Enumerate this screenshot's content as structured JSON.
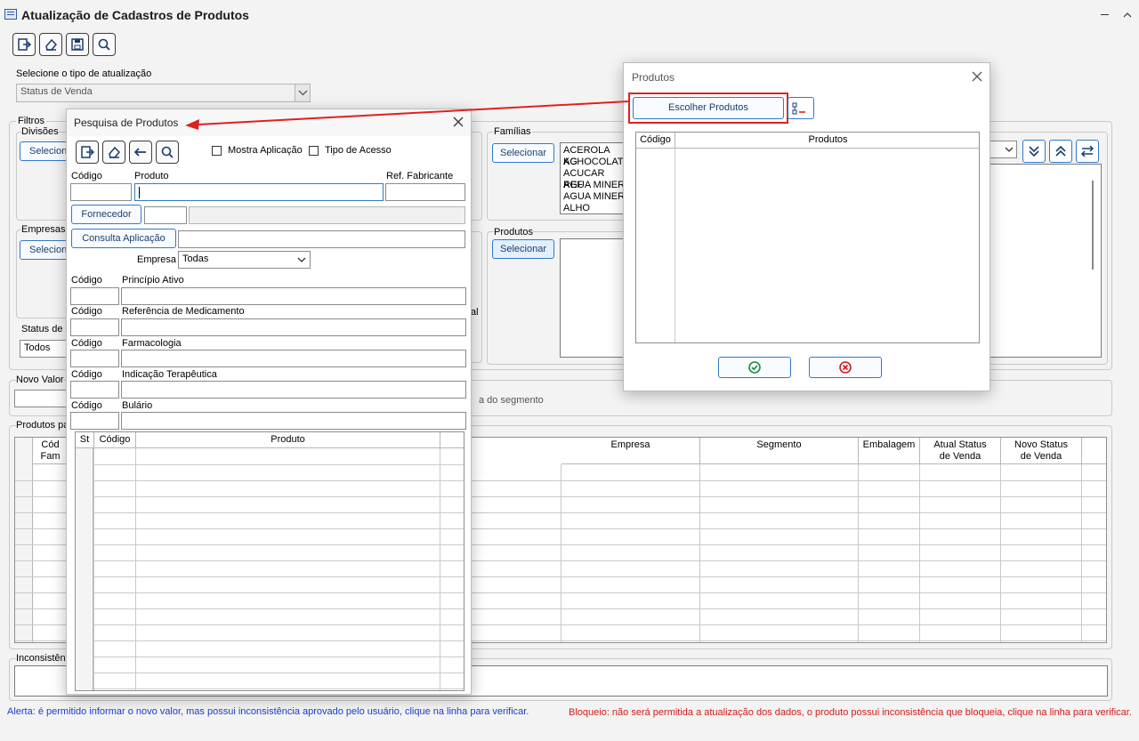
{
  "window": {
    "title": "Atualização de Cadastros de Produtos"
  },
  "update_type": {
    "label": "Selecione o tipo de atualização",
    "value": "Status de Venda"
  },
  "filters": {
    "label": "Filtros",
    "divisoes": "Divisões",
    "empresas": "Empresas",
    "status": "Status de",
    "status_value": "Todos",
    "select_label": "Selecionar",
    "familias": "Famílias",
    "produtos": "Produtos",
    "familias_list": [
      "ACEROLA KG",
      "ACHOCOLATA",
      "ACUCAR REF",
      "AGUA MINER",
      "AGUA MINER",
      "ALHO GRANE"
    ],
    "partial_text": "al"
  },
  "new_value": {
    "label": "Novo Valor",
    "hint": "a do segmento"
  },
  "products_grid": {
    "label": "Produtos pa",
    "headers_left": [
      "Cód\nFam"
    ],
    "headers": [
      "Empresa",
      "Segmento",
      "Embalagem",
      "Atual Status\nde Venda",
      "Novo Status\nde Venda"
    ]
  },
  "inconsistencias": {
    "label": "Inconsistên"
  },
  "footer": {
    "alert": "Alerta: é permitido informar o novo valor, mas possui inconsistência aprovado pelo usuário, clique na linha para verificar.",
    "block": "Bloqueio: não será permitida a atualização dos dados, o produto possui inconsistência que bloqueia, clique na linha para verificar."
  },
  "search_dialog": {
    "title": "Pesquisa de Produtos",
    "mostra_aplicacao": "Mostra Aplicação",
    "tipo_acesso": "Tipo de Acesso",
    "codigo": "Código",
    "produto": "Produto",
    "ref_fabricante": "Ref. Fabricante",
    "fornecedor": "Fornecedor",
    "consulta_aplicacao": "Consulta Aplicação",
    "empresa": "Empresa",
    "empresa_value": "Todas",
    "principio_ativo": "Princípio Ativo",
    "referencia_medicamento": "Referência de Medicamento",
    "farmacologia": "Farmacologia",
    "indicacao": "Indicação Terapêutica",
    "bulario": "Bulário",
    "grid_headers": [
      "St",
      "Código",
      "Produto"
    ]
  },
  "produtos_dialog": {
    "title": "Produtos",
    "choose": "Escolher Produtos",
    "headers": [
      "Código",
      "Produtos"
    ]
  },
  "colors": {
    "accent": "#2f7ac8",
    "highlight": "#e02020",
    "alert": "#1a3ec8",
    "block": "#d11a1a",
    "ok": "#1a8a3a"
  }
}
